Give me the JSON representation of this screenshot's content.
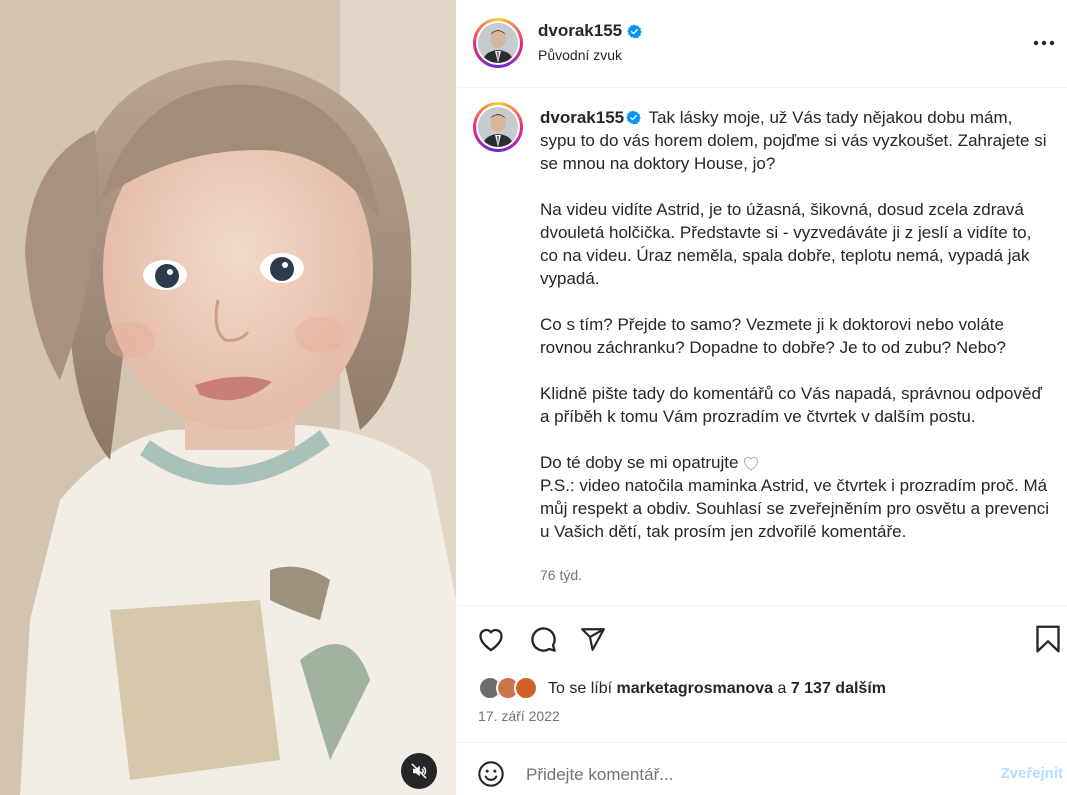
{
  "post": {
    "username": "dvorak155",
    "audio_label": "Původní zvuk",
    "verified_icon": "verified-badge-icon",
    "more_icon": "more-options-icon"
  },
  "caption": {
    "username": "dvorak155",
    "lines": [
      "Tak lásky moje, už Vás tady nějakou dobu mám, sypu to do vás horem dolem, pojďme si vás vyzkoušet. Zahrajete si se mnou na doktory House, jo?",
      "Na videu vidíte Astrid, je to úžasná, šikovná, dosud zcela zdravá dvouletá holčička. Představte si - vyzvedáváte ji z jeslí a vidíte to, co na videu. Úraz neměla, spala dobře, teplotu nemá, vypadá jak vypadá.",
      "Co s tím? Přejde to samo? Vezmete ji k doktorovi nebo voláte rovnou záchranku? Dopadne to dobře? Je to od zubu? Nebo?",
      "Klidně pište tady do komentářů co Vás napadá, správnou odpověď a příběh k tomu Vám prozradím ve čtvrtek v dalším postu.",
      "Do té doby se mi opatrujte",
      "P.S.: video natočila maminka Astrid, ve čtvrtek i prozradím proč. Má můj respekt a obdiv. Souhlasí se zveřejněním pro osvětu a prevenci u Vašich dětí, tak prosím jen zdvořilé komentáře."
    ],
    "time_ago": "76 týd."
  },
  "actions": {
    "like_icon": "heart-icon",
    "comment_icon": "comment-icon",
    "share_icon": "share-icon",
    "save_icon": "bookmark-icon"
  },
  "likes": {
    "prefix": "To se líbí",
    "user": "marketagrosmanova",
    "connector": "a",
    "count": "7 137 dalším"
  },
  "date": "17. září 2022",
  "comment": {
    "placeholder": "Přidejte komentář...",
    "post_label": "Zveřejnit",
    "emoji_icon": "emoji-icon"
  },
  "media": {
    "mute_icon": "muted-speaker-icon"
  },
  "colors": {
    "text": "#262626",
    "secondary": "#737373",
    "verified": "#0095f6",
    "post_disabled": "#b2dffc",
    "border": "#efefef"
  }
}
